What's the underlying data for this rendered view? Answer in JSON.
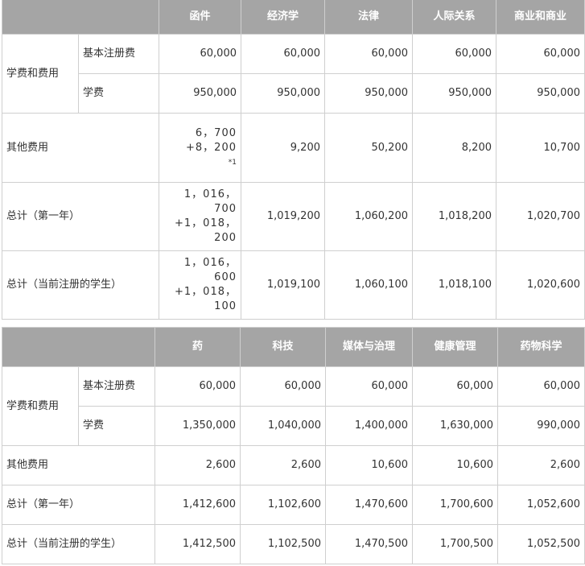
{
  "table1": {
    "headers": [
      "函件",
      "经济学",
      "法律",
      "人际关系",
      "商业和商业"
    ],
    "group_label": "学费和费用",
    "rows": [
      {
        "label": "基本注册费",
        "values": [
          "60,000",
          "60,000",
          "60,000",
          "60,000",
          "60,000"
        ]
      },
      {
        "label": "学费",
        "values": [
          "950,000",
          "950,000",
          "950,000",
          "950,000",
          "950,000"
        ]
      },
      {
        "label": "其他费用",
        "first_lines": [
          "6，700",
          "+8，200"
        ],
        "first_note": "*1",
        "values": [
          "9,200",
          "50,200",
          "8,200",
          "10,700"
        ]
      },
      {
        "label": "总计（第一年）",
        "first_lines": [
          "1，016，700",
          "+1，018，",
          "200"
        ],
        "values": [
          "1,019,200",
          "1,060,200",
          "1,018,200",
          "1,020,700"
        ]
      },
      {
        "label": "总计（当前注册的学生）",
        "first_lines": [
          "1，016，600",
          "+1，018，100"
        ],
        "values": [
          "1,019,100",
          "1,060,100",
          "1,018,100",
          "1,020,600"
        ]
      }
    ]
  },
  "table2": {
    "headers": [
      "药",
      "科技",
      "媒体与治理",
      "健康管理",
      "药物科学"
    ],
    "group_label": "学费和费用",
    "rows": [
      {
        "label": "基本注册费",
        "values": [
          "60,000",
          "60,000",
          "60,000",
          "60,000",
          "60,000"
        ]
      },
      {
        "label": "学费",
        "values": [
          "1,350,000",
          "1,040,000",
          "1,400,000",
          "1,630,000",
          "990,000"
        ]
      },
      {
        "label": "其他费用",
        "values": [
          "2,600",
          "2,600",
          "10,600",
          "10,600",
          "2,600"
        ]
      },
      {
        "label": "总计（第一年）",
        "values": [
          "1,412,600",
          "1,102,600",
          "1,470,600",
          "1,700,600",
          "1,052,600"
        ]
      },
      {
        "label": "总计（当前注册的学生）",
        "values": [
          "1,412,500",
          "1,102,500",
          "1,470,500",
          "1,700,500",
          "1,052,500"
        ]
      }
    ]
  }
}
